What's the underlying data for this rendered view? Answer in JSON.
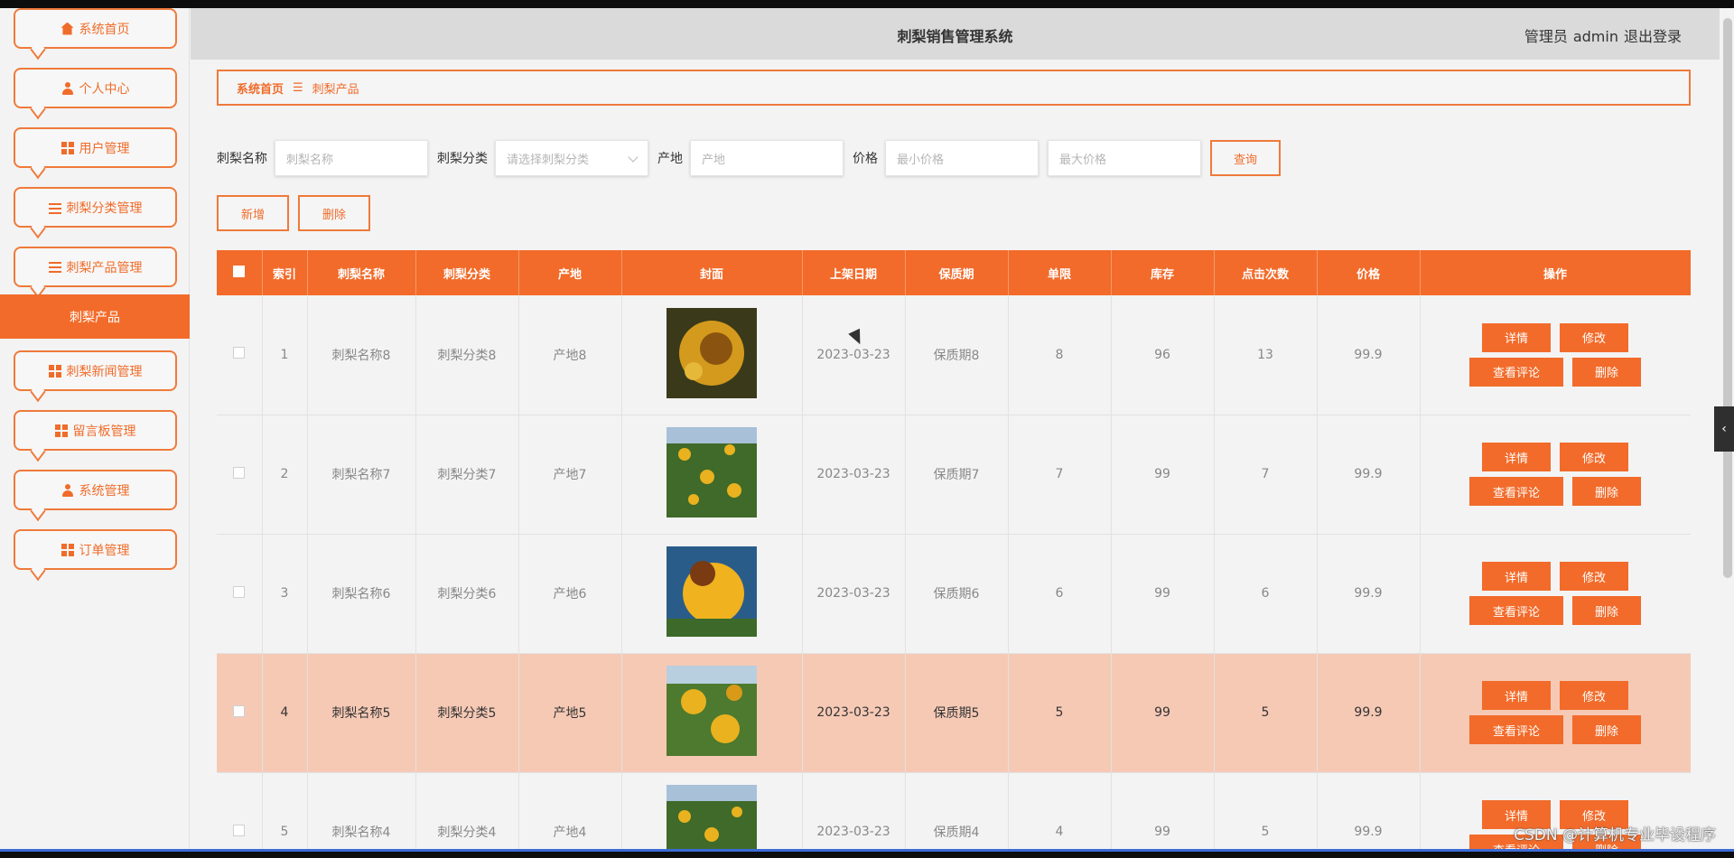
{
  "sidebar": {
    "items": [
      {
        "label": "系统首页",
        "icon": "home-icon"
      },
      {
        "label": "个人中心",
        "icon": "user-icon"
      },
      {
        "label": "用户管理",
        "icon": "grid-icon"
      },
      {
        "label": "刺梨分类管理",
        "icon": "sliders-icon"
      },
      {
        "label": "刺梨产品管理",
        "icon": "list-icon"
      },
      {
        "label": "刺梨新闻管理",
        "icon": "grid-icon"
      },
      {
        "label": "留言板管理",
        "icon": "grid-icon"
      },
      {
        "label": "系统管理",
        "icon": "user-icon"
      },
      {
        "label": "订单管理",
        "icon": "grid-icon"
      }
    ],
    "active_submenu": "刺梨产品"
  },
  "header": {
    "title": "刺梨销售管理系统",
    "role": "管理员",
    "username": "admin",
    "logout": "退出登录"
  },
  "breadcrumb": {
    "home": "系统首页",
    "separator_icon": "menu-icon",
    "current": "刺梨产品"
  },
  "search": {
    "name_label": "刺梨名称",
    "name_placeholder": "刺梨名称",
    "category_label": "刺梨分类",
    "category_placeholder": "请选择刺梨分类",
    "origin_label": "产地",
    "origin_placeholder": "产地",
    "price_label": "价格",
    "min_price_placeholder": "最小价格",
    "max_price_placeholder": "最大价格",
    "query_button": "查询"
  },
  "toolbar": {
    "add_button": "新增",
    "delete_button": "删除"
  },
  "table": {
    "columns": [
      "索引",
      "刺梨名称",
      "刺梨分类",
      "产地",
      "封面",
      "上架日期",
      "保质期",
      "单限",
      "库存",
      "点击次数",
      "价格",
      "操作"
    ],
    "rows": [
      {
        "index": "1",
        "name": "刺梨名称8",
        "category": "刺梨分类8",
        "origin": "产地8",
        "date": "2023-03-23",
        "shelf_life": "保质期8",
        "limit": "8",
        "stock": "96",
        "clicks": "13",
        "price": "99.9"
      },
      {
        "index": "2",
        "name": "刺梨名称7",
        "category": "刺梨分类7",
        "origin": "产地7",
        "date": "2023-03-23",
        "shelf_life": "保质期7",
        "limit": "7",
        "stock": "99",
        "clicks": "7",
        "price": "99.9"
      },
      {
        "index": "3",
        "name": "刺梨名称6",
        "category": "刺梨分类6",
        "origin": "产地6",
        "date": "2023-03-23",
        "shelf_life": "保质期6",
        "limit": "6",
        "stock": "99",
        "clicks": "6",
        "price": "99.9"
      },
      {
        "index": "4",
        "name": "刺梨名称5",
        "category": "刺梨分类5",
        "origin": "产地5",
        "date": "2023-03-23",
        "shelf_life": "保质期5",
        "limit": "5",
        "stock": "99",
        "clicks": "5",
        "price": "99.9"
      },
      {
        "index": "5",
        "name": "刺梨名称4",
        "category": "刺梨分类4",
        "origin": "产地4",
        "date": "2023-03-23",
        "shelf_life": "保质期4",
        "limit": "4",
        "stock": "99",
        "clicks": "5",
        "price": "99.9"
      }
    ],
    "ops": {
      "detail": "详情",
      "edit": "修改",
      "comments": "查看评论",
      "delete": "删除"
    }
  },
  "watermark": "CSDN @计算机专业毕设程序",
  "colors": {
    "accent": "#f26b2a",
    "highlight_row": "#f6c9b5",
    "header_bg": "#dadada"
  }
}
